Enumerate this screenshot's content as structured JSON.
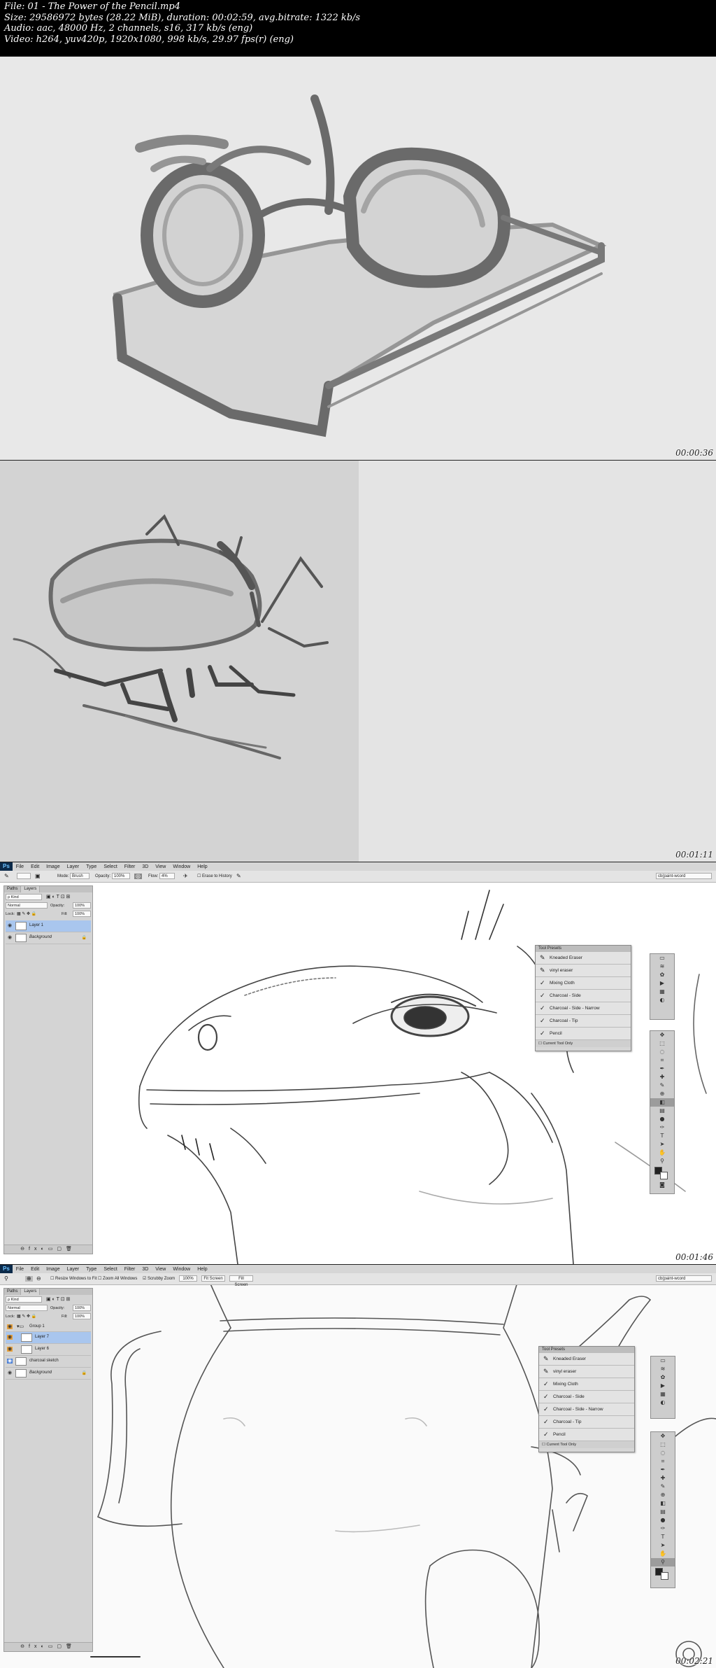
{
  "header": {
    "line1": "File: 01 - The Power of the Pencil.mp4",
    "line2": "Size: 29586972 bytes (28.22 MiB), duration: 00:02:59, avg.bitrate: 1322 kb/s",
    "line3": "Audio: aac, 48000 Hz, 2 channels, s16, 317 kb/s (eng)",
    "line4": "Video: h264, yuv420p, 1920x1080, 998 kb/s, 29.97 fps(r) (eng)"
  },
  "frames": [
    {
      "timestamp": "00:00:36",
      "subject": "glasses-on-book-sketch"
    },
    {
      "timestamp": "00:01:11",
      "subject": "beetle-sketch"
    },
    {
      "timestamp": "00:01:46",
      "subject": "lizard-sketch"
    },
    {
      "timestamp": "00:02:21",
      "subject": "teapot-sketch"
    }
  ],
  "photoshop": {
    "logo": "Ps",
    "menu": [
      "File",
      "Edit",
      "Image",
      "Layer",
      "Type",
      "Select",
      "Filter",
      "3D",
      "View",
      "Window",
      "Help"
    ],
    "workspace": "cb(paint-wcord",
    "frame3": {
      "options": {
        "mode_label": "Mode:",
        "mode_value": "Brush",
        "opacity_label": "Opacity:",
        "opacity_value": "100%",
        "flow_label": "Flow:",
        "flow_value": "4%",
        "erase_history": "Erase to History"
      },
      "layers_panel": {
        "tabs": [
          "Paths",
          "Layers"
        ],
        "filter": "Kind",
        "blend": "Normal",
        "opacity_label": "Opacity:",
        "opacity_value": "100%",
        "lock_label": "Lock:",
        "fill_label": "Fill:",
        "fill_value": "100%",
        "layers": [
          "Layer 1",
          "Background"
        ]
      },
      "tool_presets": {
        "title": "Tool Presets",
        "items": [
          "Kneaded Eraser",
          "vinyl eraser",
          "Mixing Cloth",
          "Charcoal - Side",
          "Charcoal - Side - Narrow",
          "Charcoal - Tip",
          "Pencil"
        ],
        "footer": "Current Tool Only"
      }
    },
    "frame4": {
      "options": {
        "resize_windows": "Resize Windows to Fit",
        "zoom_all": "Zoom All Windows",
        "scrubby": "Scrubby Zoom",
        "btn_100": "100%",
        "btn_fit": "Fit Screen",
        "btn_fill": "Fill Screen"
      },
      "layers_panel": {
        "tabs": [
          "Paths",
          "Layers"
        ],
        "filter": "Kind",
        "blend": "Normal",
        "opacity_label": "Opacity:",
        "opacity_value": "100%",
        "lock_label": "Lock:",
        "fill_label": "Fill:",
        "fill_value": "100%",
        "layers": [
          "Group 1",
          "Layer 7",
          "Layer 6",
          "charcoal sketch",
          "Background"
        ]
      },
      "tool_presets": {
        "title": "Tool Presets",
        "items": [
          "Kneaded Eraser",
          "vinyl eraser",
          "Mixing Cloth",
          "Charcoal - Side",
          "Charcoal - Side - Narrow",
          "Charcoal - Tip",
          "Pencil"
        ],
        "footer": "Current Tool Only"
      }
    }
  }
}
